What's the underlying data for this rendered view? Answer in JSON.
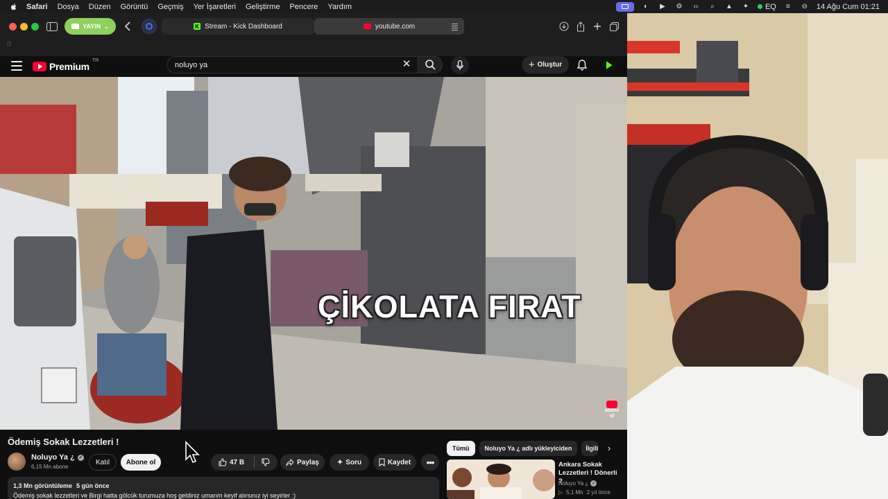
{
  "menubar": {
    "app_name": "Safari",
    "items": [
      "Dosya",
      "Düzen",
      "Görüntü",
      "Geçmiş",
      "Yer İşaretleri",
      "Geliştirme",
      "Pencere",
      "Yardım"
    ],
    "eq_label": "EQ",
    "datetime": "14 Ağu Cum  01:21"
  },
  "safari": {
    "stream_button_label": "YAYIN",
    "tabs": [
      {
        "title": "Stream - Kick Dashboard"
      },
      {
        "title": "youtube.com"
      }
    ]
  },
  "youtube": {
    "logo_word": "Premium",
    "logo_country": "TR",
    "search_value": "noluyo ya",
    "create_label": "Oluştur",
    "video_caption": "ÇİKOLATA FIRAT",
    "end_badge": "abone ol",
    "video_title": "Ödemiş Sokak Lezzetleri !",
    "channel_name": "Noluyo Ya ¿",
    "subscribers": "6,15 Mn abone",
    "join_label": "Katıl",
    "subscribe_label": "Abone ol",
    "likes": "47 B",
    "share_label": "Paylaş",
    "ask_label": "Soru",
    "save_label": "Kaydet",
    "views": "1,3 Mn görüntüleme",
    "published": "5 gün önce",
    "description": "Ödemiş sokak lezzetleri ve Birgi hatta gölcük turumuza hoş geldiniz umarım keyif alırsınız iyi seyirler :)",
    "chips": [
      "Tümü",
      "Noluyo Ya ¿ adlı yükleyiciden",
      "İlgili"
    ],
    "recommended": {
      "title": "Ankara Sokak Lezzetleri ! Dönerli ?",
      "channel": "Noluyo Ya ¿",
      "views": "5,1 Mn",
      "age": "2 yıl önce"
    }
  },
  "colors": {
    "youtube_red": "#ff0033",
    "kick_green": "#53fc18",
    "stream_button_green": "#8ed05a"
  }
}
